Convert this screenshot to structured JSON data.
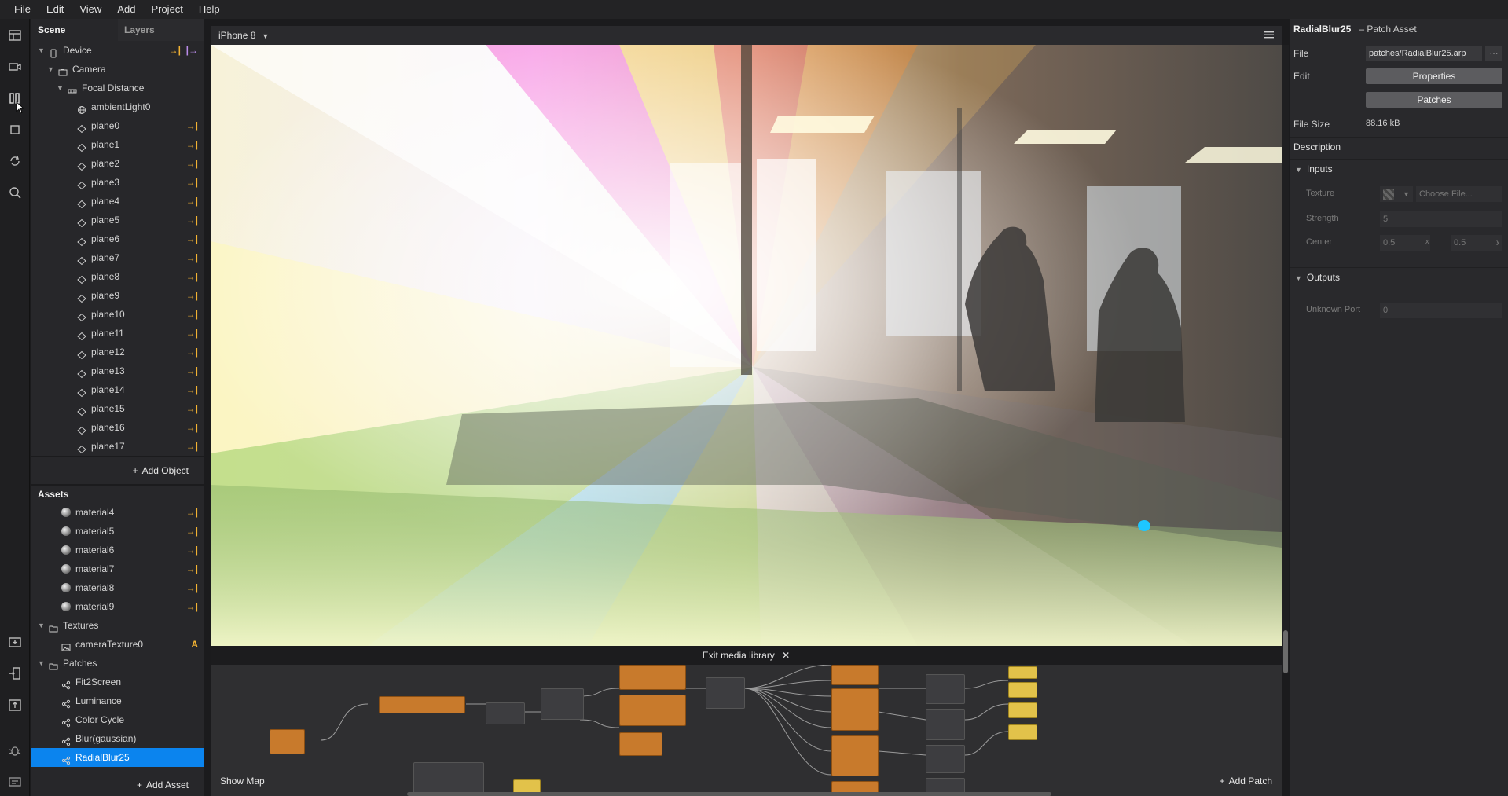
{
  "menu": [
    "File",
    "Edit",
    "View",
    "Add",
    "Project",
    "Help"
  ],
  "toolbar_icons": [
    "layout-icon",
    "video-icon",
    "patch-editor-icon",
    "object-icon",
    "refresh-icon",
    "search-icon",
    "import-icon",
    "send-to-device-icon",
    "upload-icon",
    "bug-icon",
    "console-icon"
  ],
  "scene": {
    "tabs": [
      "Scene",
      "Layers"
    ],
    "tree": [
      {
        "label": "Device",
        "depth": 0,
        "icon": "device-icon",
        "expand": true
      },
      {
        "label": "Camera",
        "depth": 1,
        "icon": "camera-icon",
        "expand": true
      },
      {
        "label": "Focal Distance",
        "depth": 2,
        "icon": "focal-distance-icon",
        "expand": true
      },
      {
        "label": "ambientLight0",
        "depth": 3,
        "icon": "light-icon"
      },
      {
        "label": "plane0",
        "depth": 3,
        "icon": "plane-icon"
      },
      {
        "label": "plane1",
        "depth": 3,
        "icon": "plane-icon"
      },
      {
        "label": "plane2",
        "depth": 3,
        "icon": "plane-icon"
      },
      {
        "label": "plane3",
        "depth": 3,
        "icon": "plane-icon"
      },
      {
        "label": "plane4",
        "depth": 3,
        "icon": "plane-icon"
      },
      {
        "label": "plane5",
        "depth": 3,
        "icon": "plane-icon"
      },
      {
        "label": "plane6",
        "depth": 3,
        "icon": "plane-icon"
      },
      {
        "label": "plane7",
        "depth": 3,
        "icon": "plane-icon"
      },
      {
        "label": "plane8",
        "depth": 3,
        "icon": "plane-icon"
      },
      {
        "label": "plane9",
        "depth": 3,
        "icon": "plane-icon"
      },
      {
        "label": "plane10",
        "depth": 3,
        "icon": "plane-icon"
      },
      {
        "label": "plane11",
        "depth": 3,
        "icon": "plane-icon"
      },
      {
        "label": "plane12",
        "depth": 3,
        "icon": "plane-icon"
      },
      {
        "label": "plane13",
        "depth": 3,
        "icon": "plane-icon"
      },
      {
        "label": "plane14",
        "depth": 3,
        "icon": "plane-icon"
      },
      {
        "label": "plane15",
        "depth": 3,
        "icon": "plane-icon"
      },
      {
        "label": "plane16",
        "depth": 3,
        "icon": "plane-icon"
      },
      {
        "label": "plane17",
        "depth": 3,
        "icon": "plane-icon"
      }
    ],
    "add_object": "Add Object"
  },
  "assets": {
    "title": "Assets",
    "rows": [
      {
        "label": "material4",
        "type": "material"
      },
      {
        "label": "material5",
        "type": "material"
      },
      {
        "label": "material6",
        "type": "material"
      },
      {
        "label": "material7",
        "type": "material"
      },
      {
        "label": "material8",
        "type": "material"
      },
      {
        "label": "material9",
        "type": "material"
      },
      {
        "label": "Textures",
        "type": "folder"
      },
      {
        "label": "cameraTexture0",
        "type": "texture",
        "badge": "A"
      },
      {
        "label": "Patches",
        "type": "folder"
      },
      {
        "label": "Fit2Screen",
        "type": "patch"
      },
      {
        "label": "Luminance",
        "type": "patch"
      },
      {
        "label": "Color Cycle",
        "type": "patch"
      },
      {
        "label": "Blur(gaussian)",
        "type": "patch"
      },
      {
        "label": "RadialBlur25",
        "type": "patch",
        "selected": true
      }
    ],
    "add_asset": "Add Asset"
  },
  "viewport": {
    "device": "iPhone 8",
    "exit_media": "Exit media library"
  },
  "patch_editor": {
    "show_map": "Show Map",
    "add_patch": "Add Patch"
  },
  "inspector": {
    "title": "RadialBlur25",
    "subtitle": "– Patch Asset",
    "file_label": "File",
    "file_value": "patches/RadialBlur25.arp",
    "edit_label": "Edit",
    "properties_btn": "Properties",
    "patches_btn": "Patches",
    "file_size_label": "File Size",
    "file_size_value": "88.16 kB",
    "description_label": "Description",
    "inputs_label": "Inputs",
    "texture_label": "Texture",
    "choose_file": "Choose File...",
    "strength_label": "Strength",
    "strength_value": "5",
    "center_label": "Center",
    "center_x": "0.5",
    "center_y": "0.5",
    "center_x_axis": "x",
    "center_y_axis": "y",
    "outputs_label": "Outputs",
    "unknown_port_label": "Unknown Port",
    "unknown_port_value": "0"
  },
  "colors": {
    "link": "#f2b233",
    "selection": "#0b84ee",
    "patch_node": "#c87a2c"
  }
}
